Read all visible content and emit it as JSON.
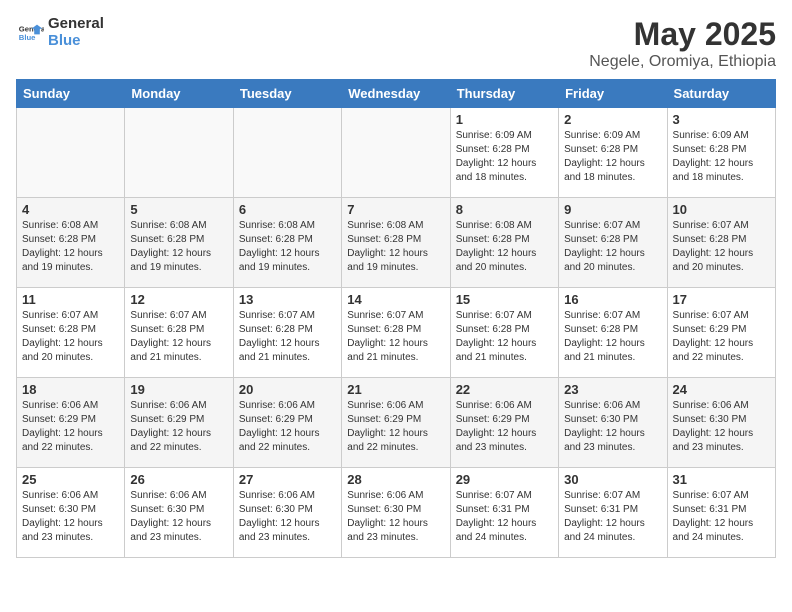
{
  "header": {
    "logo_general": "General",
    "logo_blue": "Blue",
    "title": "May 2025",
    "subtitle": "Negele, Oromiya, Ethiopia"
  },
  "days_of_week": [
    "Sunday",
    "Monday",
    "Tuesday",
    "Wednesday",
    "Thursday",
    "Friday",
    "Saturday"
  ],
  "weeks": [
    [
      {
        "num": "",
        "info": ""
      },
      {
        "num": "",
        "info": ""
      },
      {
        "num": "",
        "info": ""
      },
      {
        "num": "",
        "info": ""
      },
      {
        "num": "1",
        "info": "Sunrise: 6:09 AM\nSunset: 6:28 PM\nDaylight: 12 hours\nand 18 minutes."
      },
      {
        "num": "2",
        "info": "Sunrise: 6:09 AM\nSunset: 6:28 PM\nDaylight: 12 hours\nand 18 minutes."
      },
      {
        "num": "3",
        "info": "Sunrise: 6:09 AM\nSunset: 6:28 PM\nDaylight: 12 hours\nand 18 minutes."
      }
    ],
    [
      {
        "num": "4",
        "info": "Sunrise: 6:08 AM\nSunset: 6:28 PM\nDaylight: 12 hours\nand 19 minutes."
      },
      {
        "num": "5",
        "info": "Sunrise: 6:08 AM\nSunset: 6:28 PM\nDaylight: 12 hours\nand 19 minutes."
      },
      {
        "num": "6",
        "info": "Sunrise: 6:08 AM\nSunset: 6:28 PM\nDaylight: 12 hours\nand 19 minutes."
      },
      {
        "num": "7",
        "info": "Sunrise: 6:08 AM\nSunset: 6:28 PM\nDaylight: 12 hours\nand 19 minutes."
      },
      {
        "num": "8",
        "info": "Sunrise: 6:08 AM\nSunset: 6:28 PM\nDaylight: 12 hours\nand 20 minutes."
      },
      {
        "num": "9",
        "info": "Sunrise: 6:07 AM\nSunset: 6:28 PM\nDaylight: 12 hours\nand 20 minutes."
      },
      {
        "num": "10",
        "info": "Sunrise: 6:07 AM\nSunset: 6:28 PM\nDaylight: 12 hours\nand 20 minutes."
      }
    ],
    [
      {
        "num": "11",
        "info": "Sunrise: 6:07 AM\nSunset: 6:28 PM\nDaylight: 12 hours\nand 20 minutes."
      },
      {
        "num": "12",
        "info": "Sunrise: 6:07 AM\nSunset: 6:28 PM\nDaylight: 12 hours\nand 21 minutes."
      },
      {
        "num": "13",
        "info": "Sunrise: 6:07 AM\nSunset: 6:28 PM\nDaylight: 12 hours\nand 21 minutes."
      },
      {
        "num": "14",
        "info": "Sunrise: 6:07 AM\nSunset: 6:28 PM\nDaylight: 12 hours\nand 21 minutes."
      },
      {
        "num": "15",
        "info": "Sunrise: 6:07 AM\nSunset: 6:28 PM\nDaylight: 12 hours\nand 21 minutes."
      },
      {
        "num": "16",
        "info": "Sunrise: 6:07 AM\nSunset: 6:28 PM\nDaylight: 12 hours\nand 21 minutes."
      },
      {
        "num": "17",
        "info": "Sunrise: 6:07 AM\nSunset: 6:29 PM\nDaylight: 12 hours\nand 22 minutes."
      }
    ],
    [
      {
        "num": "18",
        "info": "Sunrise: 6:06 AM\nSunset: 6:29 PM\nDaylight: 12 hours\nand 22 minutes."
      },
      {
        "num": "19",
        "info": "Sunrise: 6:06 AM\nSunset: 6:29 PM\nDaylight: 12 hours\nand 22 minutes."
      },
      {
        "num": "20",
        "info": "Sunrise: 6:06 AM\nSunset: 6:29 PM\nDaylight: 12 hours\nand 22 minutes."
      },
      {
        "num": "21",
        "info": "Sunrise: 6:06 AM\nSunset: 6:29 PM\nDaylight: 12 hours\nand 22 minutes."
      },
      {
        "num": "22",
        "info": "Sunrise: 6:06 AM\nSunset: 6:29 PM\nDaylight: 12 hours\nand 23 minutes."
      },
      {
        "num": "23",
        "info": "Sunrise: 6:06 AM\nSunset: 6:30 PM\nDaylight: 12 hours\nand 23 minutes."
      },
      {
        "num": "24",
        "info": "Sunrise: 6:06 AM\nSunset: 6:30 PM\nDaylight: 12 hours\nand 23 minutes."
      }
    ],
    [
      {
        "num": "25",
        "info": "Sunrise: 6:06 AM\nSunset: 6:30 PM\nDaylight: 12 hours\nand 23 minutes."
      },
      {
        "num": "26",
        "info": "Sunrise: 6:06 AM\nSunset: 6:30 PM\nDaylight: 12 hours\nand 23 minutes."
      },
      {
        "num": "27",
        "info": "Sunrise: 6:06 AM\nSunset: 6:30 PM\nDaylight: 12 hours\nand 23 minutes."
      },
      {
        "num": "28",
        "info": "Sunrise: 6:06 AM\nSunset: 6:30 PM\nDaylight: 12 hours\nand 23 minutes."
      },
      {
        "num": "29",
        "info": "Sunrise: 6:07 AM\nSunset: 6:31 PM\nDaylight: 12 hours\nand 24 minutes."
      },
      {
        "num": "30",
        "info": "Sunrise: 6:07 AM\nSunset: 6:31 PM\nDaylight: 12 hours\nand 24 minutes."
      },
      {
        "num": "31",
        "info": "Sunrise: 6:07 AM\nSunset: 6:31 PM\nDaylight: 12 hours\nand 24 minutes."
      }
    ]
  ]
}
